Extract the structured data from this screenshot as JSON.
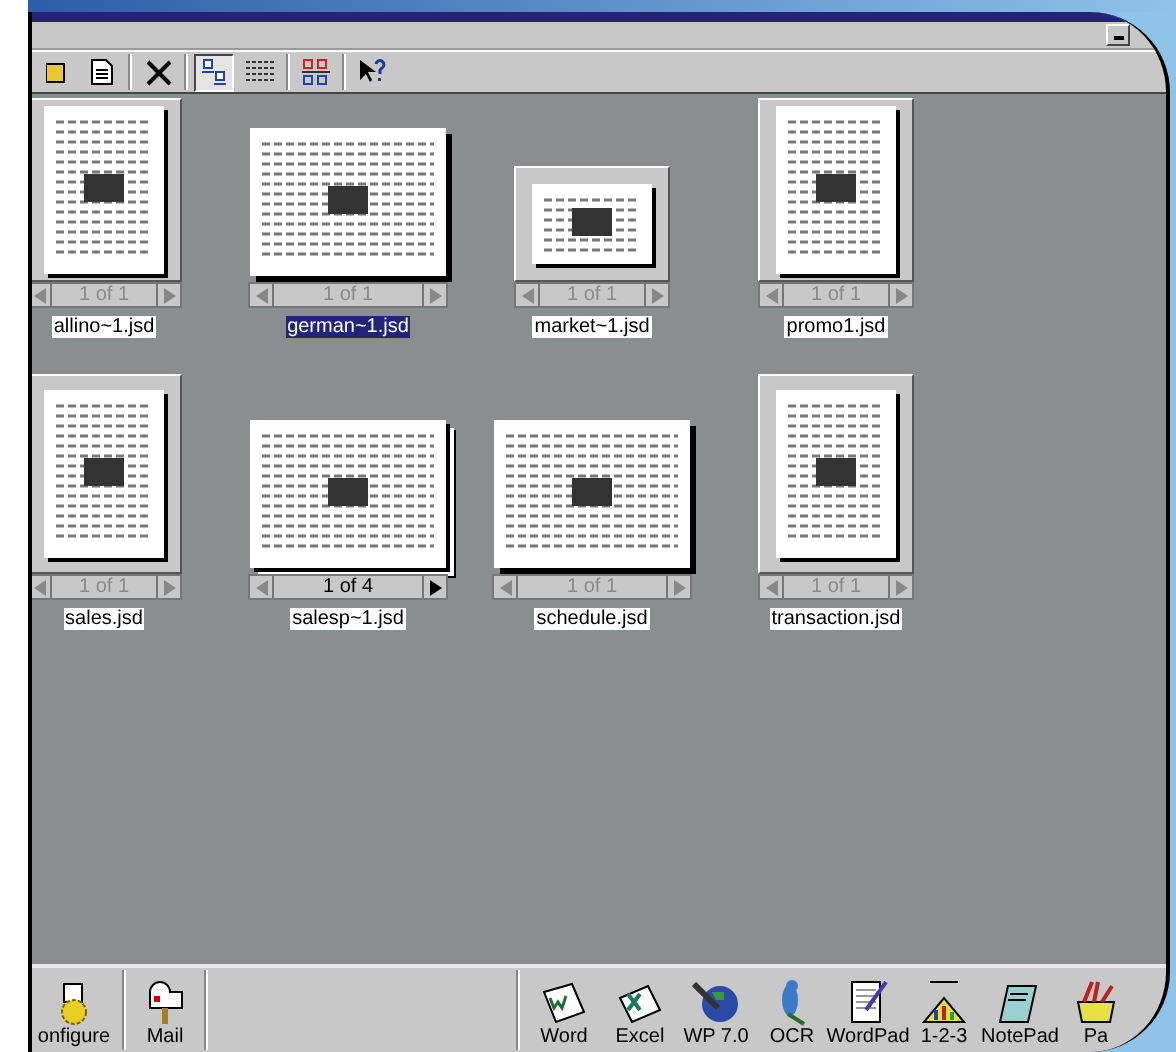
{
  "toolbar": [
    {
      "kind": "open",
      "selected": false
    },
    {
      "kind": "page",
      "selected": false
    },
    {
      "kind": "delete",
      "selected": false
    },
    {
      "kind": "thumbnails",
      "selected": true
    },
    {
      "kind": "grid",
      "selected": false
    },
    {
      "kind": "arrange",
      "selected": false
    },
    {
      "kind": "help",
      "selected": false
    }
  ],
  "documents": [
    {
      "name": "allino~1.jsd",
      "pages": "1 of 1",
      "kind": "portrait",
      "selected": false,
      "multipage": false
    },
    {
      "name": "german~1.jsd",
      "pages": "1 of 1",
      "kind": "sheet",
      "selected": true,
      "multipage": false
    },
    {
      "name": "market~1.jsd",
      "pages": "1 of 1",
      "kind": "landscape",
      "selected": false,
      "multipage": false
    },
    {
      "name": "promo1.jsd",
      "pages": "1 of 1",
      "kind": "portrait",
      "selected": false,
      "multipage": false
    },
    {
      "name": "sales.jsd",
      "pages": "1 of 1",
      "kind": "portrait",
      "selected": false,
      "multipage": false
    },
    {
      "name": "salesp~1.jsd",
      "pages": "1 of 4",
      "kind": "sheet",
      "selected": false,
      "multipage": true
    },
    {
      "name": "schedule.jsd",
      "pages": "1 of 1",
      "kind": "sheet",
      "selected": false,
      "multipage": false
    },
    {
      "name": "transaction.jsd",
      "pages": "1 of 1",
      "kind": "portrait",
      "selected": false,
      "multipage": false
    }
  ],
  "launcher_left": [
    {
      "label": "onfigure"
    },
    {
      "label": "Mail"
    }
  ],
  "launcher_apps": [
    {
      "label": "Word"
    },
    {
      "label": "Excel"
    },
    {
      "label": "WP 7.0"
    },
    {
      "label": "OCR"
    },
    {
      "label": "WordPad"
    },
    {
      "label": "1-2-3"
    },
    {
      "label": "NotePad"
    },
    {
      "label": "Pa"
    }
  ]
}
